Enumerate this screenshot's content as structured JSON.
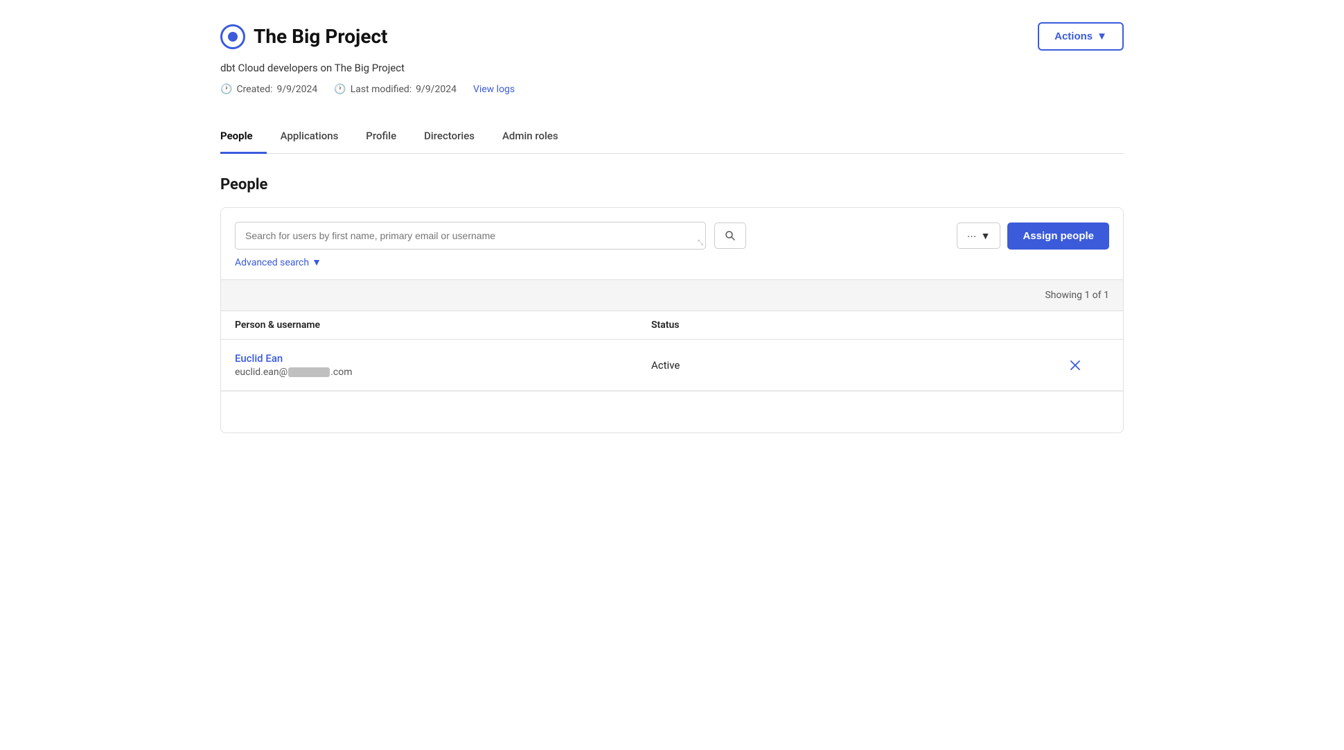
{
  "header": {
    "title": "The Big Project",
    "subtitle": "dbt Cloud developers on The Big Project",
    "created_label": "Created:",
    "created_date": "9/9/2024",
    "modified_label": "Last modified:",
    "modified_date": "9/9/2024",
    "view_logs_label": "View logs",
    "actions_label": "Actions"
  },
  "tabs": [
    {
      "id": "people",
      "label": "People",
      "active": true
    },
    {
      "id": "applications",
      "label": "Applications",
      "active": false
    },
    {
      "id": "profile",
      "label": "Profile",
      "active": false
    },
    {
      "id": "directories",
      "label": "Directories",
      "active": false
    },
    {
      "id": "admin-roles",
      "label": "Admin roles",
      "active": false
    }
  ],
  "people_section": {
    "title": "People",
    "search_placeholder": "Search for users by first name, primary email or username",
    "advanced_search_label": "Advanced search",
    "showing_label": "Showing 1 of 1",
    "more_actions_label": "···",
    "assign_people_label": "Assign people",
    "table": {
      "columns": [
        {
          "key": "person",
          "label": "Person & username"
        },
        {
          "key": "status",
          "label": "Status"
        },
        {
          "key": "actions",
          "label": ""
        }
      ],
      "rows": [
        {
          "name": "Euclid Ean",
          "email_prefix": "euclid.ean@",
          "email_suffix": ".com",
          "status": "Active"
        }
      ]
    }
  },
  "colors": {
    "accent": "#3b5bdb",
    "active_status": "#222"
  }
}
